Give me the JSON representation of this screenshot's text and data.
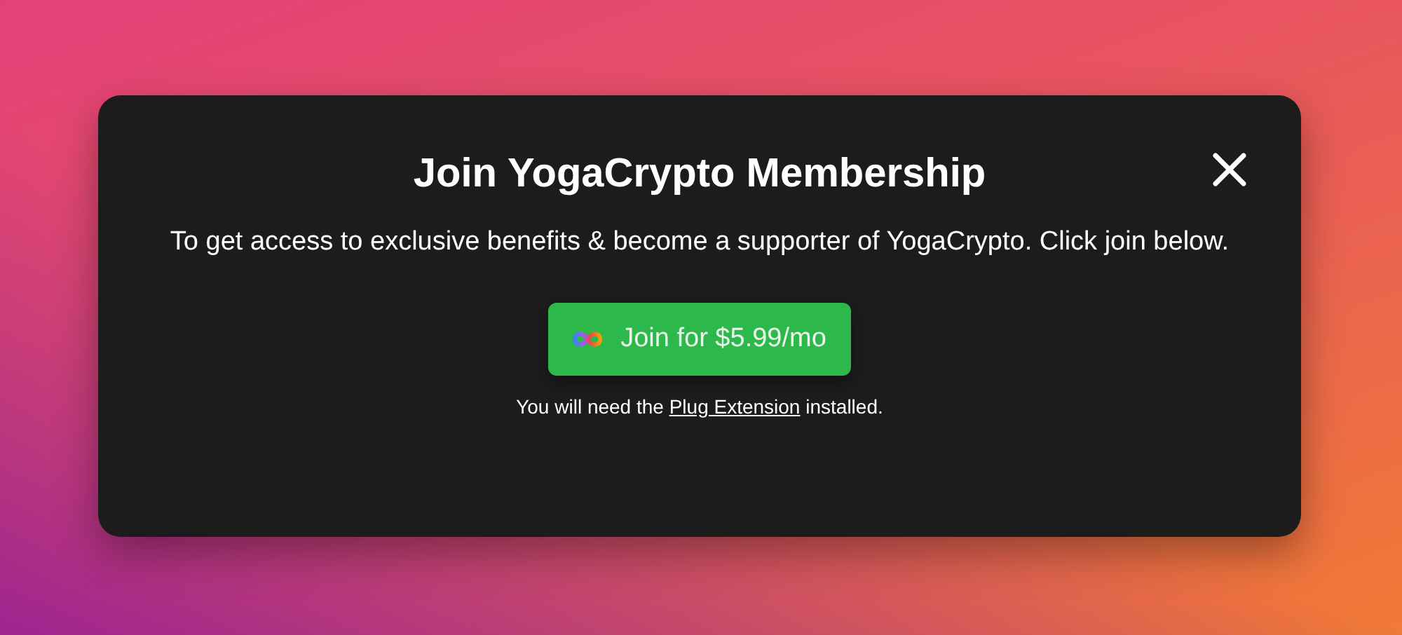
{
  "dialog": {
    "title": "Join YogaCrypto Membership",
    "description": "To get access to exclusive benefits & become a supporter of YogaCrypto. Click join below.",
    "join_button": "Join for $5.99/mo",
    "note": {
      "before": "You will need the ",
      "link": "Plug Extension",
      "after": " installed."
    }
  }
}
